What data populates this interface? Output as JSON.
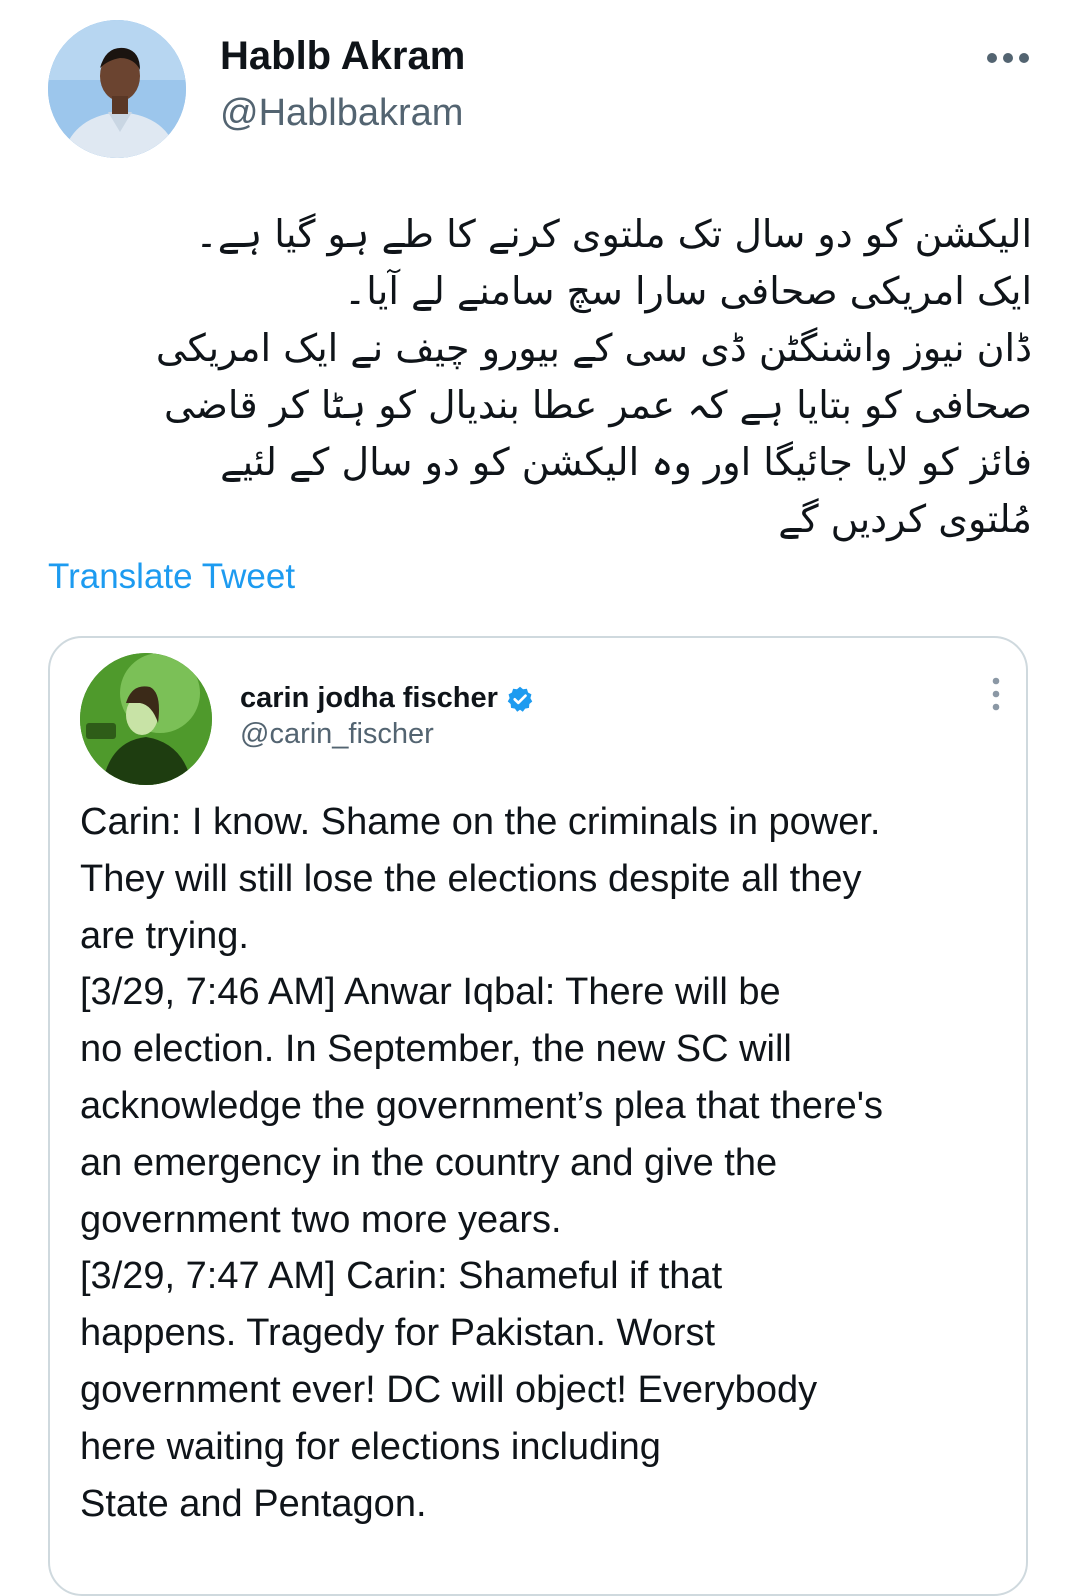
{
  "tweet": {
    "author_name": "Hablb Akram",
    "author_handle": "@Hablbakram",
    "more_icon": "more-horizontal-icon",
    "urdu_lines": [
      "الیکشن کو دو سال تک ملتوی کرنے کا طے ہو گیا ہے۔",
      "ایک امریکی صحافی سارا سچ سامنے لے آیا۔",
      "ڈان نیوز واشنگٹن ڈی سی کے بیورو چیف نے ایک امریکی",
      "صحافی کو بتایا ہے کہ عمر عطا بندیال کو ہٹا کر قاضی",
      "فائز کو لایا جائیگا اور وہ الیکشن کو دو سال کے لئیے",
      "مُلتوی کردیں گے"
    ],
    "translate_label": "Translate Tweet"
  },
  "quoted": {
    "name": "carin jodha fischer",
    "handle": "@carin_fischer",
    "verified_icon": "verified-badge-icon",
    "more_icon": "more-vertical-icon",
    "lines": [
      "Carin: I know. Shame on the criminals in power.",
      "They will still lose the elections despite all they",
      "are trying.",
      "[3/29, 7:46 AM] Anwar Iqbal: There will be",
      "no election. In September,  the new SC will",
      "acknowledge the government’s plea that there's",
      "an emergency in the country and give the",
      "government two more years.",
      "[3/29, 7:47 AM] Carin: Shameful if that",
      "happens. Tragedy for Pakistan. Worst",
      "government ever! DC will object! Everybody",
      "here waiting for elections including",
      "State and Pentagon."
    ]
  },
  "colors": {
    "text": "#0f1419",
    "secondary": "#536471",
    "link": "#1d9bf0",
    "border": "#cfd9de"
  }
}
